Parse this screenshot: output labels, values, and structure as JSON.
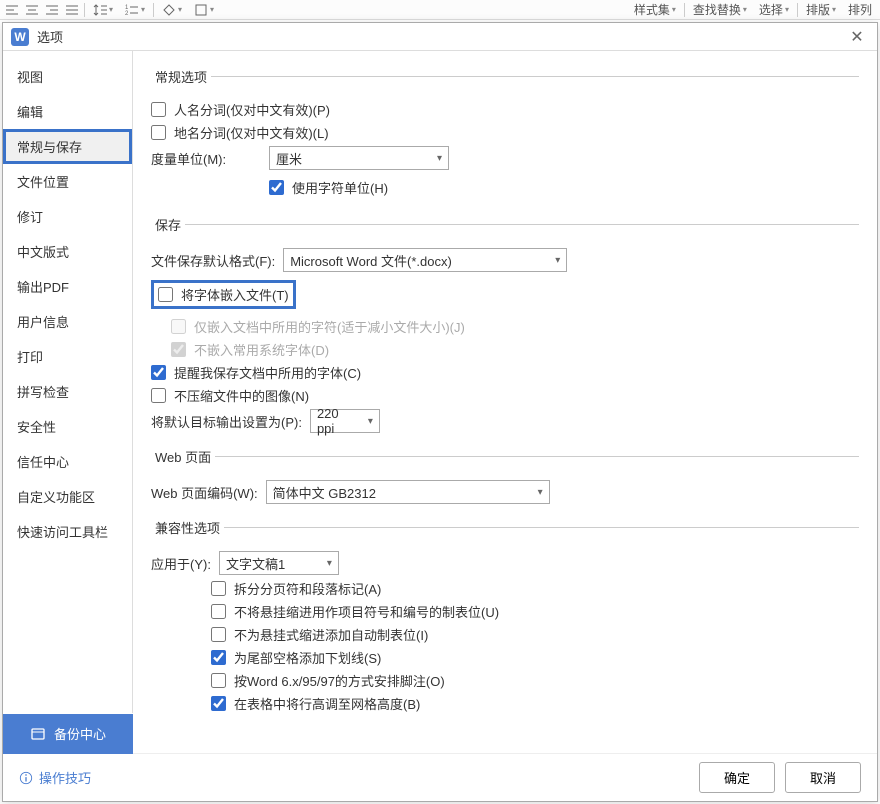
{
  "toolbar": {
    "right_items": [
      "样式集",
      "查找替换",
      "选择",
      "排版",
      "排列"
    ]
  },
  "dialog": {
    "title": "选项"
  },
  "sidebar": {
    "items": [
      {
        "label": "视图"
      },
      {
        "label": "编辑"
      },
      {
        "label": "常规与保存",
        "active": true,
        "highlight": true
      },
      {
        "label": "文件位置"
      },
      {
        "label": "修订"
      },
      {
        "label": "中文版式"
      },
      {
        "label": "输出PDF"
      },
      {
        "label": "用户信息"
      },
      {
        "label": "打印"
      },
      {
        "label": "拼写检查"
      },
      {
        "label": "安全性"
      },
      {
        "label": "信任中心"
      },
      {
        "label": "自定义功能区"
      },
      {
        "label": "快速访问工具栏"
      }
    ]
  },
  "general": {
    "legend": "常规选项",
    "name_seg": "人名分词(仅对中文有效)(P)",
    "place_seg": "地名分词(仅对中文有效)(L)",
    "unit_label": "度量单位(M):",
    "unit_value": "厘米",
    "use_char_unit": "使用字符单位(H)"
  },
  "save": {
    "legend": "保存",
    "default_fmt_label": "文件保存默认格式(F):",
    "default_fmt_value": "Microsoft Word 文件(*.docx)",
    "embed_fonts": "将字体嵌入文件(T)",
    "only_used": "仅嵌入文档中所用的字符(适于减小文件大小)(J)",
    "not_embed_sys": "不嵌入常用系统字体(D)",
    "remind_fonts": "提醒我保存文档中所用的字体(C)",
    "no_compress_img": "不压缩文件中的图像(N)",
    "default_output_label": "将默认目标输出设置为(P):",
    "default_output_value": "220 ppi"
  },
  "web": {
    "legend": "Web 页面",
    "enc_label": "Web 页面编码(W):",
    "enc_value": "简体中文 GB2312"
  },
  "compat": {
    "legend": "兼容性选项",
    "apply_label": "应用于(Y):",
    "apply_value": "文字文稿1",
    "split_page": "拆分分页符和段落标记(A)",
    "no_hang_indent_tab": "不将悬挂缩进用作项目符号和编号的制表位(U)",
    "no_auto_tab": "不为悬挂式缩进添加自动制表位(I)",
    "trail_underline": "为尾部空格添加下划线(S)",
    "word6_footnote": "按Word 6.x/95/97的方式安排脚注(O)",
    "row_height_grid": "在表格中将行高调至网格高度(B)"
  },
  "footer": {
    "backup": "备份中心",
    "tips": "操作技巧",
    "ok": "确定",
    "cancel": "取消"
  }
}
